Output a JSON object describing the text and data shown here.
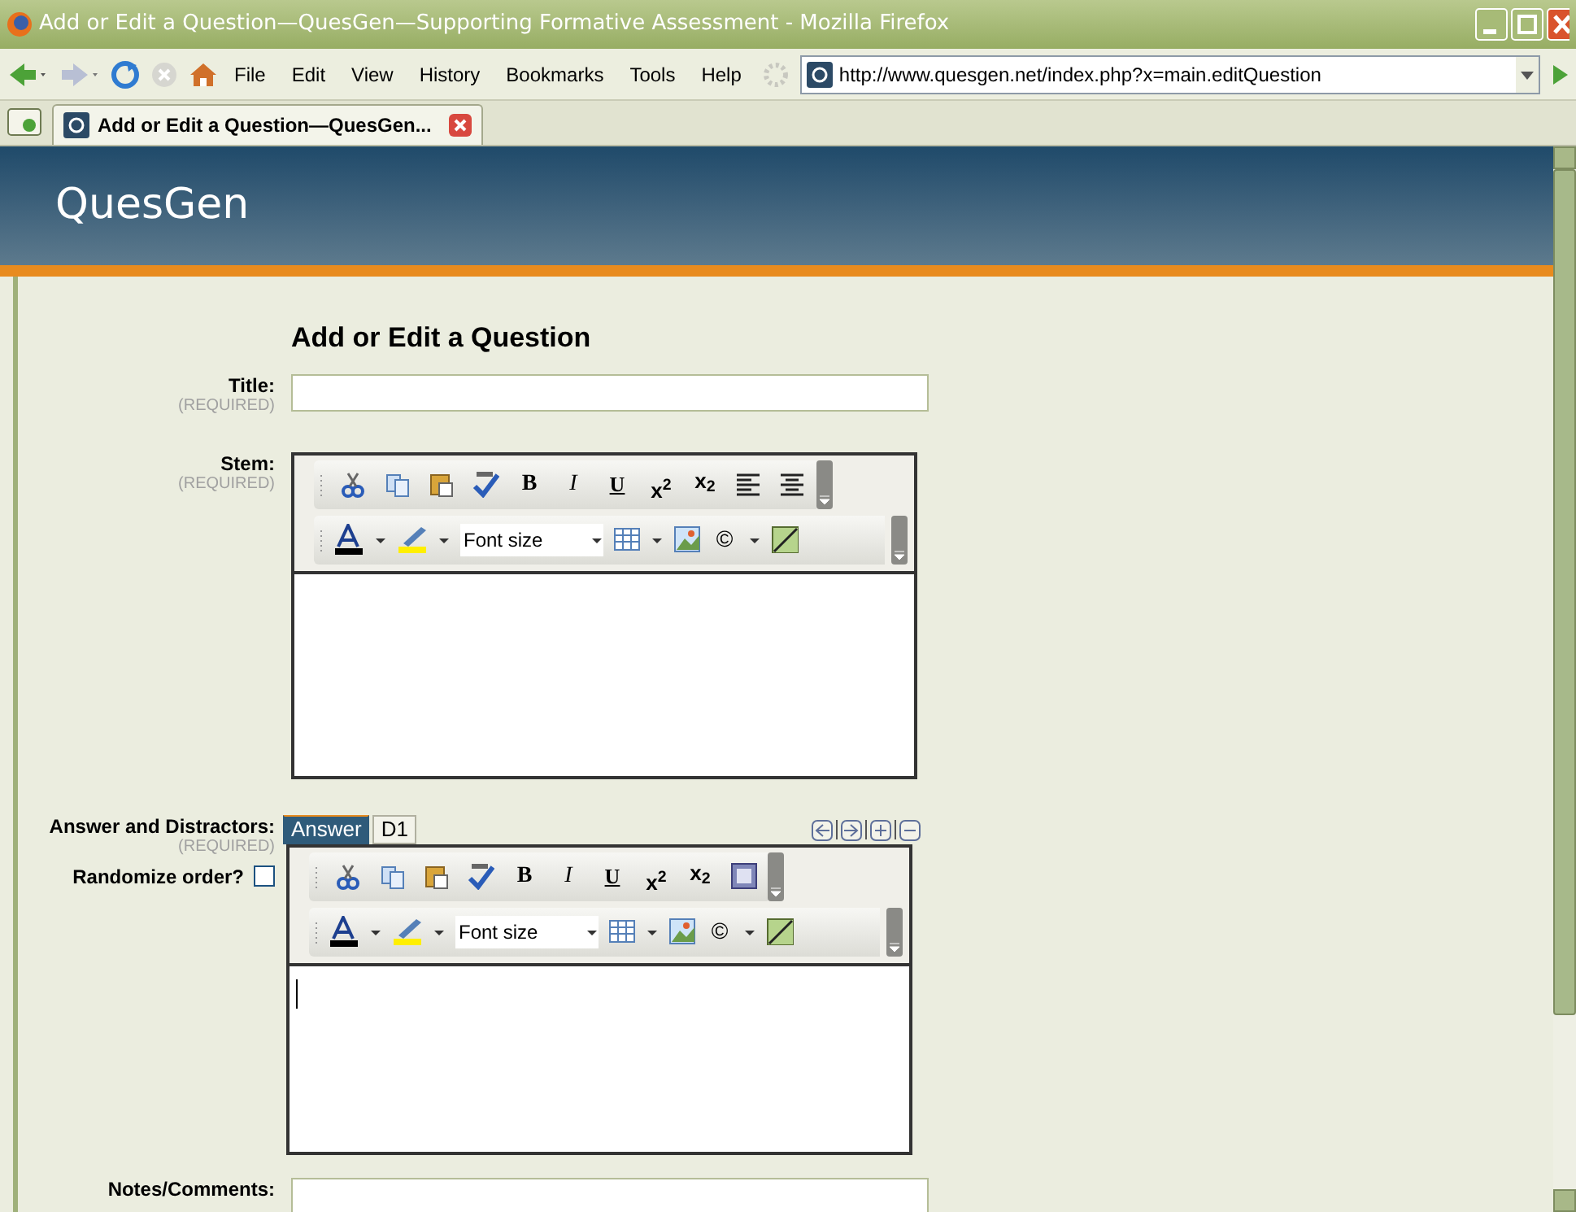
{
  "window": {
    "title": "Add or Edit a Question—QuesGen—Supporting Formative Assessment - Mozilla Firefox"
  },
  "menu": [
    "File",
    "Edit",
    "View",
    "History",
    "Bookmarks",
    "Tools",
    "Help"
  ],
  "address": "http://www.quesgen.net/index.php?x=main.editQuestion",
  "tabs": [
    {
      "label": "Add or Edit a Question—QuesGen...",
      "selected": true
    }
  ],
  "site": {
    "logo": "QuesGen"
  },
  "form": {
    "heading": "Add or Edit a Question",
    "title_field": {
      "label": "Title:",
      "note": "(REQUIRED)"
    },
    "stem": {
      "label": "Stem:",
      "note": "(REQUIRED)",
      "row1": [
        {
          "kind": "cut"
        },
        {
          "kind": "copy"
        },
        {
          "kind": "paste"
        },
        {
          "kind": "spell"
        },
        {
          "kind": "bold",
          "glyph": "B"
        },
        {
          "kind": "italic",
          "glyph": "I"
        },
        {
          "kind": "underline",
          "glyph": "U"
        },
        {
          "kind": "sup",
          "glyph": "x$^{2}$"
        },
        {
          "kind": "sub",
          "glyph": "x$_{2}$"
        },
        {
          "kind": "left"
        },
        {
          "kind": "center"
        }
      ],
      "row2": [
        {
          "kind": "font_color"
        },
        {
          "kind": "highlight"
        },
        {
          "kind": "font_size",
          "label": "Font size"
        },
        {
          "kind": "table"
        },
        {
          "kind": "image"
        },
        {
          "kind": "copyright",
          "glyph": "©"
        },
        {
          "kind": "wh"
        }
      ]
    },
    "answers": {
      "label": "Answer and Distractors:",
      "note": "(REQUIRED)",
      "tabs": [
        {
          "label": "Answer",
          "selected": true
        },
        {
          "label": "D1",
          "selected": false
        }
      ],
      "row1": [
        {
          "kind": "cut"
        },
        {
          "kind": "copy"
        },
        {
          "kind": "paste"
        },
        {
          "kind": "spell"
        },
        {
          "kind": "bold",
          "glyph": "B"
        },
        {
          "kind": "italic",
          "glyph": "I"
        },
        {
          "kind": "underline",
          "glyph": "U"
        },
        {
          "kind": "sup",
          "glyph": "x$^{2}$"
        },
        {
          "kind": "sub",
          "glyph": "x$_{2}$"
        },
        {
          "kind": "source"
        }
      ],
      "row2": [
        {
          "kind": "font_color"
        },
        {
          "kind": "highlight"
        },
        {
          "kind": "font_size",
          "label": "Font size"
        },
        {
          "kind": "table"
        },
        {
          "kind": "image"
        },
        {
          "kind": "copyright",
          "glyph": "©"
        },
        {
          "kind": "wh"
        }
      ]
    },
    "randomize": {
      "label": "Randomize order?",
      "checked": false
    },
    "notes": {
      "label": "Notes/Comments:"
    }
  }
}
